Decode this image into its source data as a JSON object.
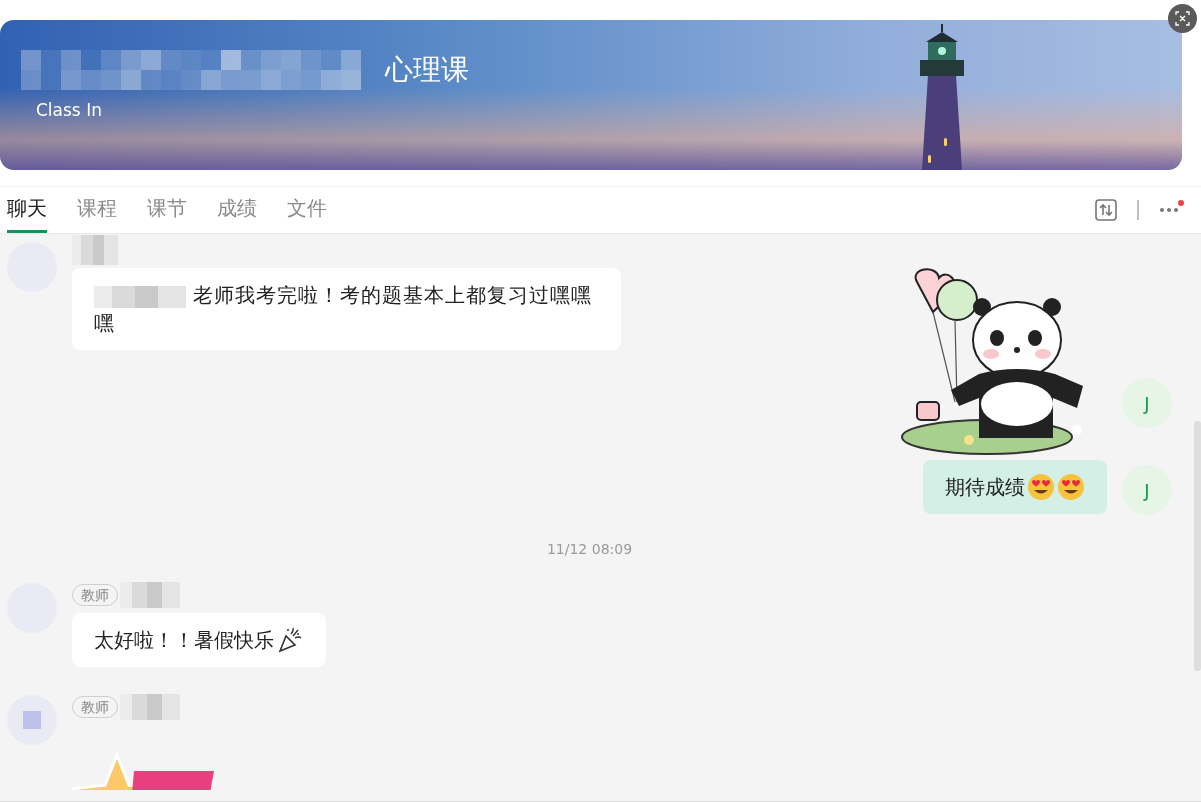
{
  "banner": {
    "title": "心理课",
    "subtitle": "Class In"
  },
  "tabs": [
    {
      "label": "聊天",
      "selected": true
    },
    {
      "label": "课程",
      "selected": false
    },
    {
      "label": "课节",
      "selected": false
    },
    {
      "label": "成绩",
      "selected": false
    },
    {
      "label": "文件",
      "selected": false
    }
  ],
  "more_menu": {
    "has_notification": true
  },
  "messages": [
    {
      "kind": "received",
      "mention": true,
      "text": "老师我考完啦！考的题基本上都复习过嘿嘿嘿"
    },
    {
      "kind": "panda",
      "avatar": "J"
    },
    {
      "kind": "sent",
      "avatar": "J",
      "text": "期待成绩",
      "emojis": [
        {
          "kind": "hearteyes"
        },
        {
          "kind": "hearteyes"
        }
      ]
    },
    {
      "kind": "time",
      "text": "11/12 08:09"
    },
    {
      "kind": "received",
      "role": "教师",
      "text": "太好啦！！暑假快乐",
      "emojis": [
        {
          "kind": "party"
        }
      ]
    },
    {
      "kind": "star",
      "role": "教师"
    }
  ]
}
